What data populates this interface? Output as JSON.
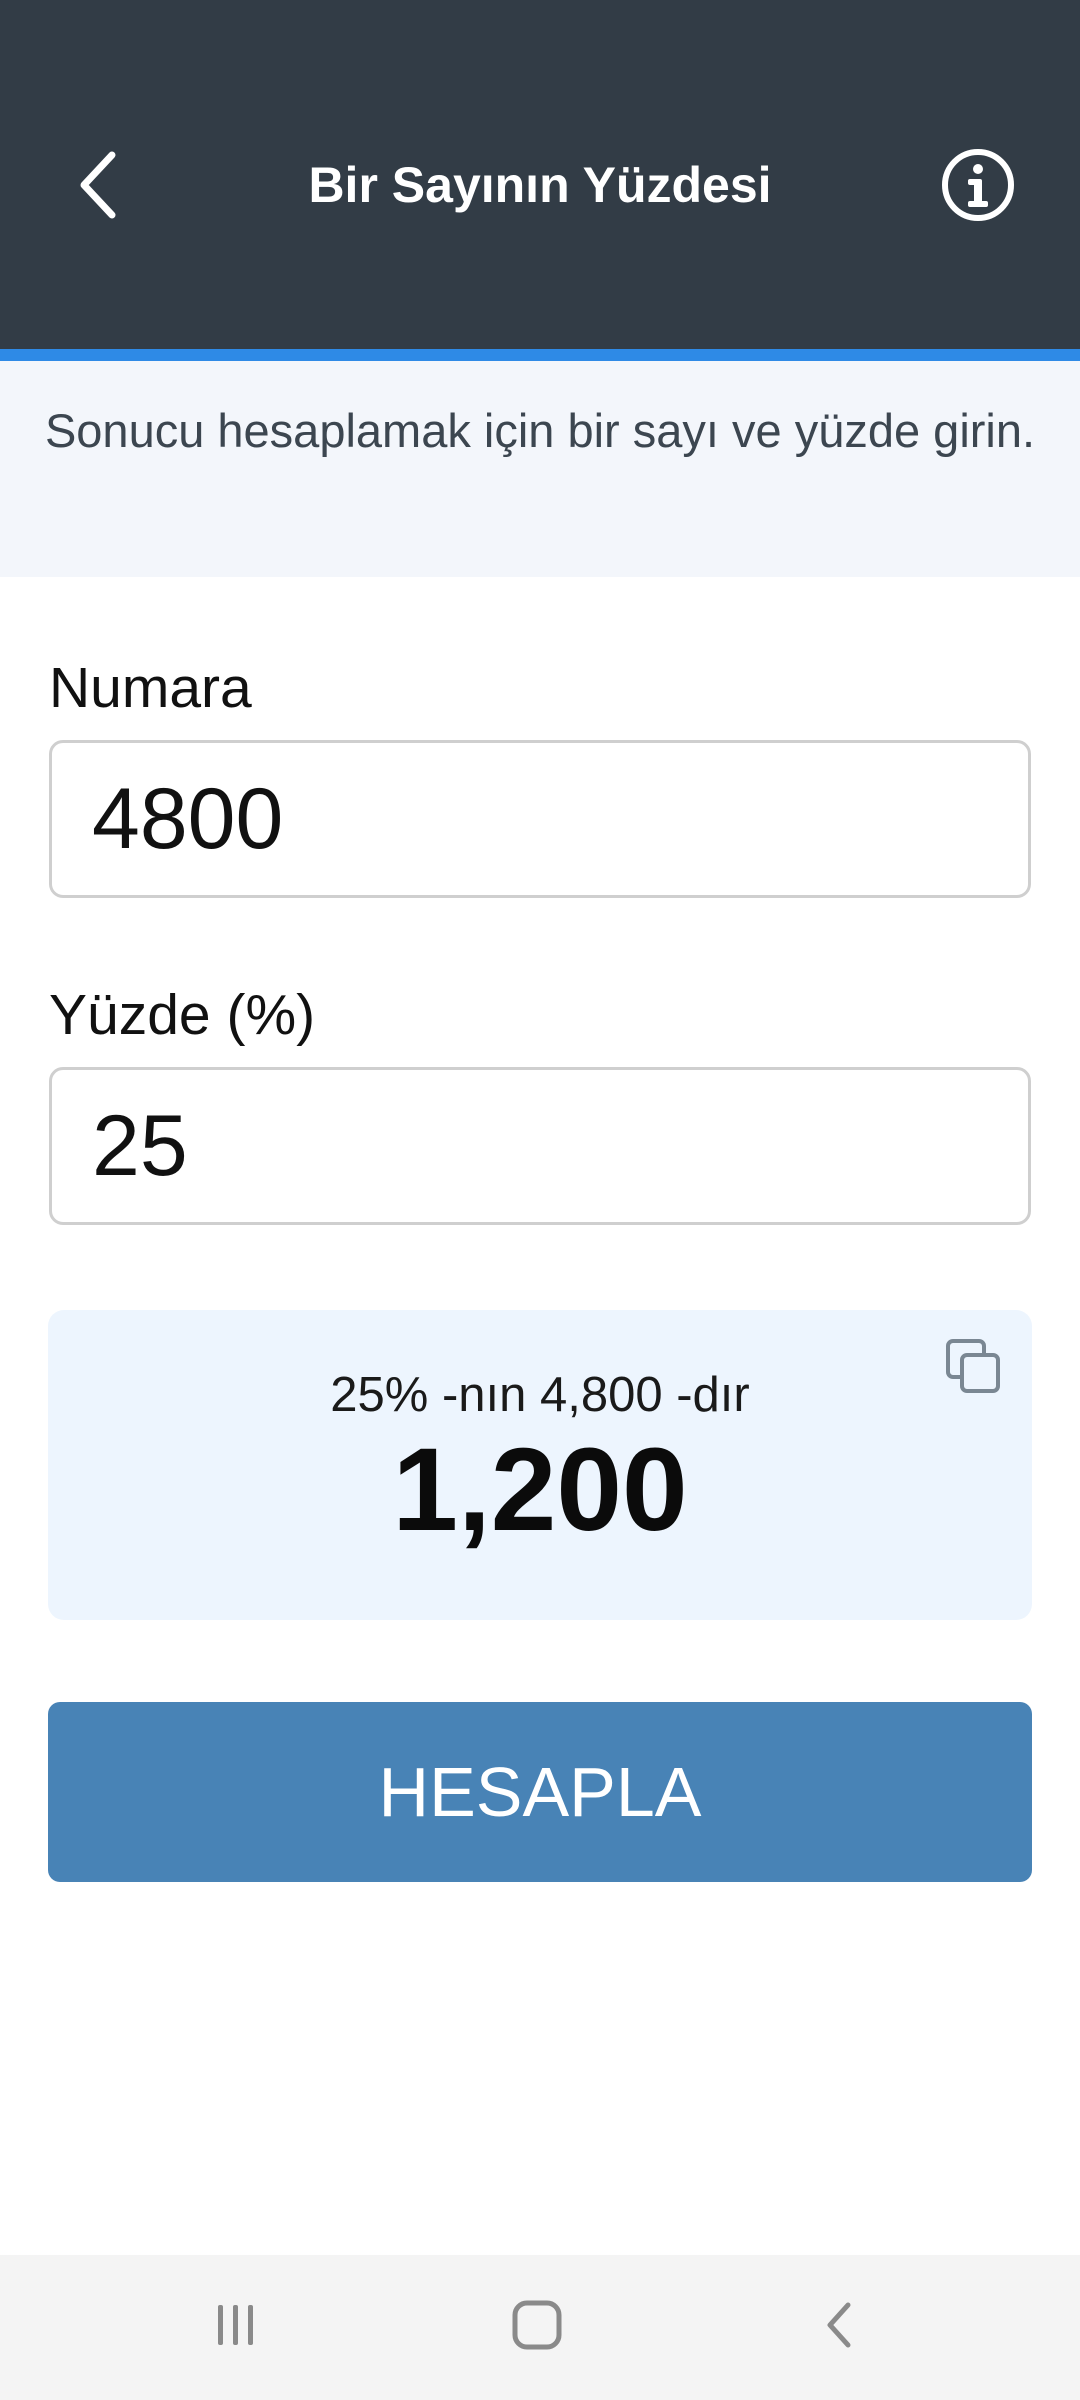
{
  "header": {
    "title": "Bir Sayının Yüzdesi",
    "back_icon": "chevron-left-icon",
    "info_icon": "info-circle-icon",
    "background": "#323c46",
    "accent": "#2e8ae6"
  },
  "intro": {
    "text": "Sonucu hesaplamak için bir sayı ve yüzde girin."
  },
  "form": {
    "number_label": "Numara",
    "number_value": "4800",
    "percent_label": "Yüzde (%)",
    "percent_value": "25"
  },
  "result": {
    "sentence": "25% -nın 4,800 -dır",
    "value": "1,200",
    "copy_icon": "copy-icon",
    "background": "#edf5fe"
  },
  "actions": {
    "calculate_label": "HESAPLA",
    "calculate_color": "#4883b6"
  },
  "system_nav": {
    "recents_icon": "recents-icon",
    "home_icon": "home-icon",
    "back_icon": "back-icon"
  }
}
